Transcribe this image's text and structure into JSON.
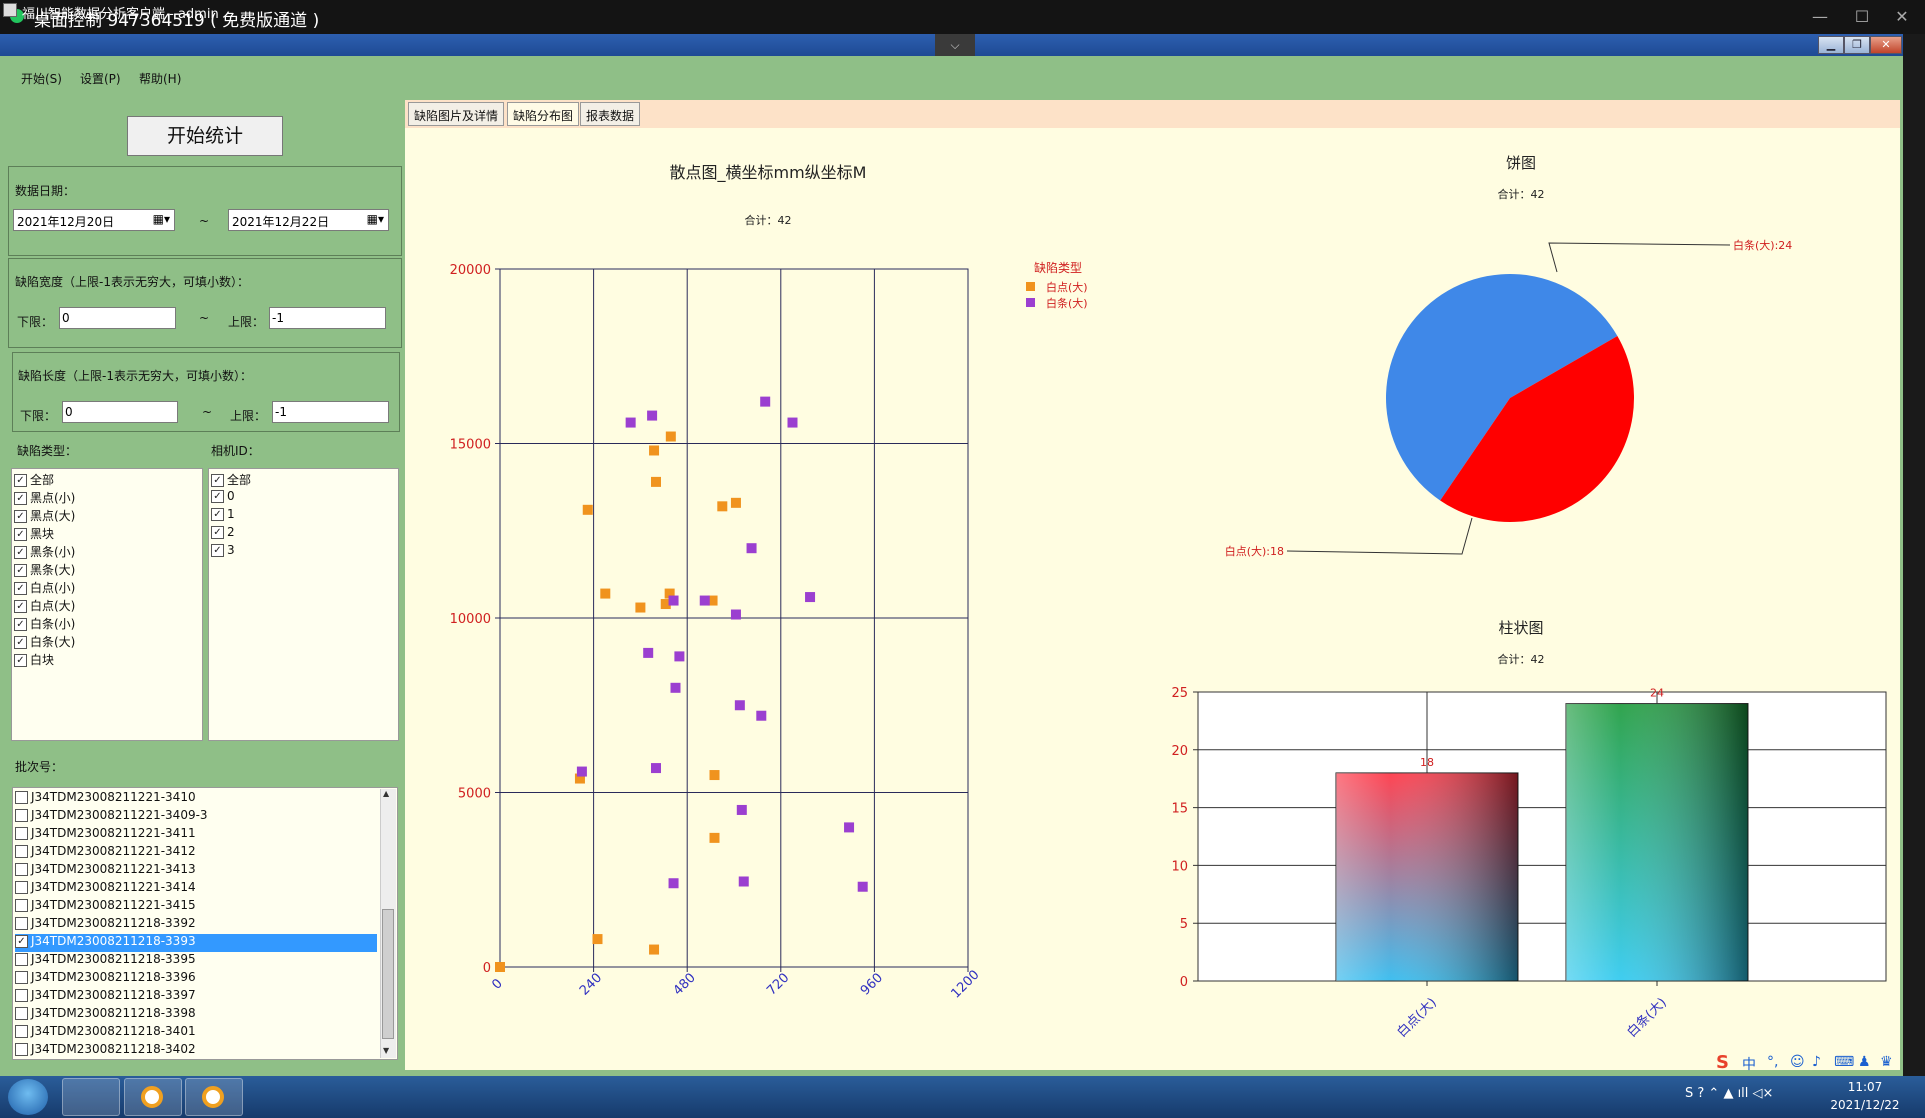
{
  "remote": {
    "title": "桌面控制 947364519 ( 免费版通道 )"
  },
  "app": {
    "title": "福川智能数据分析客户端 - admin"
  },
  "menu": [
    "开始(S)",
    "设置(P)",
    "帮助(H)"
  ],
  "start_button": "开始统计",
  "date": {
    "label": "数据日期：",
    "from": "2021年12月20日",
    "to": "2021年12月22日",
    "sep": "~"
  },
  "width_filter": {
    "label": "缺陷宽度（上限-1表示无穷大，可填小数）：",
    "lower_label": "下限：",
    "lower": "0",
    "sep": "~",
    "upper_label": "上限：",
    "upper": "-1"
  },
  "length_filter": {
    "label": "缺陷长度（上限-1表示无穷大，可填小数）：",
    "lower_label": "下限：",
    "lower": "0",
    "sep": "~",
    "upper_label": "上限：",
    "upper": "-1"
  },
  "defect_types": {
    "label": "缺陷类型：",
    "items": [
      "全部",
      "黑点(小)",
      "黑点(大)",
      "黑块",
      "黑条(小)",
      "黑条(大)",
      "白点(小)",
      "白点(大)",
      "白条(小)",
      "白条(大)",
      "白块"
    ]
  },
  "camera_ids": {
    "label": "相机ID：",
    "items": [
      "全部",
      "0",
      "1",
      "2",
      "3"
    ]
  },
  "batch": {
    "label": "批次号：",
    "selected_index": 8,
    "items": [
      "J34TDM23008211221-3410",
      "J34TDM23008211221-3409-3",
      "J34TDM23008211221-3411",
      "J34TDM23008211221-3412",
      "J34TDM23008211221-3413",
      "J34TDM23008211221-3414",
      "J34TDM23008211221-3415",
      "J34TDM23008211218-3392",
      "J34TDM23008211218-3393",
      "J34TDM23008211218-3395",
      "J34TDM23008211218-3396",
      "J34TDM23008211218-3397",
      "J34TDM23008211218-3398",
      "J34TDM23008211218-3401",
      "J34TDM23008211218-3402"
    ]
  },
  "tabs": [
    "缺陷图片及详情",
    "缺陷分布图",
    "报表数据"
  ],
  "active_tab": 1,
  "colors": {
    "orange": "#f0931e",
    "purple": "#9b3fd0",
    "pie_blue": "#3f88e8",
    "pie_red": "#ff0000",
    "client_bg": "#8fbf87",
    "chart_bg": "#fffde1"
  },
  "taskbar": {
    "time": "11:07",
    "date": "2021/12/22"
  },
  "chart_data": [
    {
      "type": "scatter",
      "title": "散点图_横坐标mm纵坐标M",
      "subtitle": "合计：42",
      "legend_title": "缺陷类型",
      "legend_position": "top-right",
      "xlim": [
        0,
        1200
      ],
      "ylim": [
        0,
        20000
      ],
      "xticks": [
        0,
        240,
        480,
        720,
        960,
        1200
      ],
      "yticks": [
        0,
        5000,
        10000,
        15000,
        20000
      ],
      "grid": true,
      "series": [
        {
          "name": "白点(大)",
          "color": "#f0931e",
          "points": [
            [
              0,
              0
            ],
            [
              205,
              5400
            ],
            [
              225,
              13100
            ],
            [
              250,
              800
            ],
            [
              270,
              10700
            ],
            [
              360,
              10300
            ],
            [
              395,
              14800
            ],
            [
              400,
              13900
            ],
            [
              395,
              500
            ],
            [
              425,
              10400
            ],
            [
              435,
              10700
            ],
            [
              438,
              15200
            ],
            [
              545,
              10500
            ],
            [
              550,
              5500
            ],
            [
              550,
              3700
            ],
            [
              570,
              13200
            ],
            [
              605,
              13300
            ]
          ]
        },
        {
          "name": "白条(大)",
          "color": "#9b3fd0",
          "points": [
            [
              210,
              5600
            ],
            [
              335,
              15600
            ],
            [
              380,
              9000
            ],
            [
              390,
              15800
            ],
            [
              400,
              5700
            ],
            [
              445,
              10500
            ],
            [
              445,
              2400
            ],
            [
              450,
              8000
            ],
            [
              460,
              8900
            ],
            [
              525,
              10500
            ],
            [
              605,
              10100
            ],
            [
              615,
              7500
            ],
            [
              620,
              4500
            ],
            [
              625,
              2450
            ],
            [
              645,
              12000
            ],
            [
              670,
              7200
            ],
            [
              680,
              16200
            ],
            [
              750,
              15600
            ],
            [
              795,
              10600
            ],
            [
              895,
              4000
            ],
            [
              930,
              2300
            ]
          ]
        }
      ]
    },
    {
      "type": "pie",
      "title": "饼图",
      "subtitle": "合计：42",
      "slices": [
        {
          "label": "白条(大)",
          "value": 24,
          "color": "#3f88e8"
        },
        {
          "label": "白点(大)",
          "value": 18,
          "color": "#ff0000"
        }
      ],
      "slice_labels": [
        "白条(大):24",
        "白点(大):18"
      ]
    },
    {
      "type": "bar",
      "title": "柱状图",
      "subtitle": "合计：42",
      "categories": [
        "白点(大)",
        "白条(大)"
      ],
      "values": [
        18,
        24
      ],
      "ylim": [
        0,
        25
      ],
      "yticks": [
        0,
        5,
        10,
        15,
        20,
        25
      ],
      "grid": true
    }
  ]
}
